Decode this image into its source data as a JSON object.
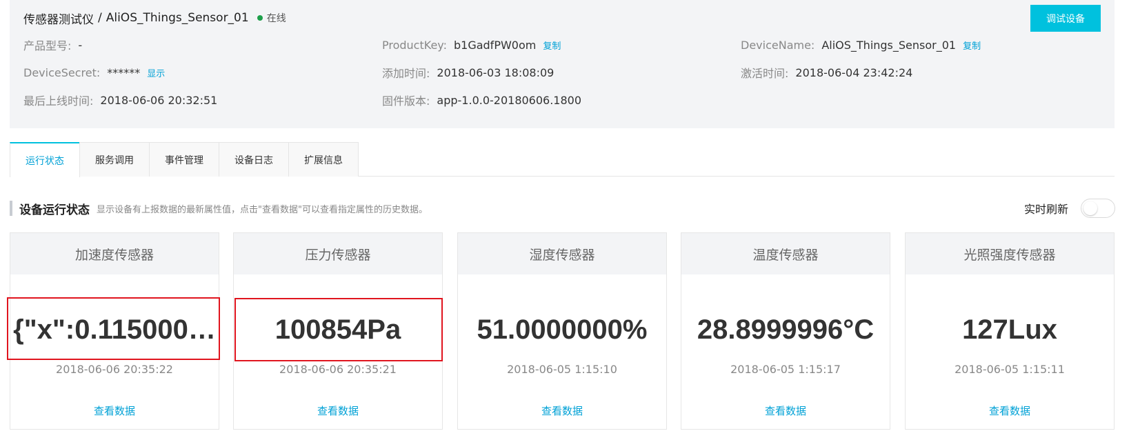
{
  "header": {
    "product_name": "传感器测试仪",
    "separator": "/",
    "device_name": "AliOS_Things_Sensor_01",
    "status": "在线",
    "status_color": "#1e9f4a",
    "debug_button": "调试设备",
    "fields": {
      "model_label": "产品型号:",
      "model_value": "-",
      "product_key_label": "ProductKey:",
      "product_key_value": "b1GadfPW0om",
      "product_key_copy": "复制",
      "device_name_label": "DeviceName:",
      "device_name_value": "AliOS_Things_Sensor_01",
      "device_name_copy": "复制",
      "device_secret_label": "DeviceSecret:",
      "device_secret_value": "******",
      "device_secret_show": "显示",
      "added_label": "添加时间:",
      "added_value": "2018-06-03 18:08:09",
      "activated_label": "激活时间:",
      "activated_value": "2018-06-04 23:42:24",
      "last_online_label": "最后上线时间:",
      "last_online_value": "2018-06-06 20:32:51",
      "firmware_label": "固件版本:",
      "firmware_value": "app-1.0.0-20180606.1800"
    }
  },
  "tabs": [
    {
      "label": "运行状态",
      "active": true
    },
    {
      "label": "服务调用",
      "active": false
    },
    {
      "label": "事件管理",
      "active": false
    },
    {
      "label": "设备日志",
      "active": false
    },
    {
      "label": "扩展信息",
      "active": false
    }
  ],
  "section": {
    "title": "设备运行状态",
    "description": "显示设备有上报数据的最新属性值，点击\"查看数据\"可以查看指定属性的历史数据。",
    "realtime_label": "实时刷新",
    "realtime_on": false
  },
  "cards": [
    {
      "title": "加速度传感器",
      "value": "{\"x\":0.115000…",
      "time": "2018-06-06 20:35:22",
      "link": "查看数据"
    },
    {
      "title": "压力传感器",
      "value": "100854Pa",
      "time": "2018-06-06 20:35:21",
      "link": "查看数据"
    },
    {
      "title": "湿度传感器",
      "value": "51.0000000%",
      "time": "2018-06-05 1:15:10",
      "link": "查看数据"
    },
    {
      "title": "温度传感器",
      "value": "28.8999996°C",
      "time": "2018-06-05 1:15:17",
      "link": "查看数据"
    },
    {
      "title": "光照强度传感器",
      "value": "127Lux",
      "time": "2018-06-05 1:15:11",
      "link": "查看数据"
    }
  ],
  "colors": {
    "accent": "#00c1de",
    "link": "#00a1d6",
    "highlight": "#e0141e"
  }
}
